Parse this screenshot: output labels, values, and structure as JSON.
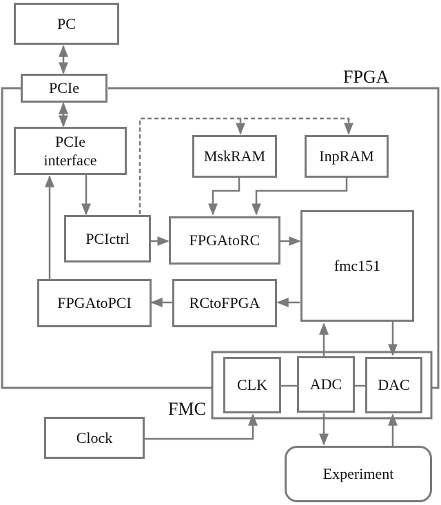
{
  "diagram": {
    "regions": {
      "fpga": "FPGA",
      "fmc": "FMC"
    },
    "blocks": {
      "pc": "PC",
      "pcie": "PCIe",
      "pcie_interface_line1": "PCIe",
      "pcie_interface_line2": "interface",
      "mskram": "MskRAM",
      "inpram": "InpRAM",
      "pcictrl": "PCIctrl",
      "fpgatorc": "FPGAtoRC",
      "fmc151": "fmc151",
      "fpgatopci": "FPGAtoPCI",
      "rctofpga": "RCtoFPGA",
      "clk": "CLK",
      "adc": "ADC",
      "dac": "DAC",
      "clock": "Clock",
      "experiment": "Experiment"
    },
    "connections": [
      {
        "from": "PC",
        "to": "PCIe",
        "type": "bidirectional"
      },
      {
        "from": "PCIe",
        "to": "PCIe interface",
        "type": "bidirectional"
      },
      {
        "from": "PCIe interface",
        "to": "PCIctrl",
        "type": "arrow"
      },
      {
        "from": "PCIctrl",
        "to": "MskRAM",
        "type": "dashed-arrow"
      },
      {
        "from": "PCIctrl",
        "to": "InpRAM",
        "type": "dashed-arrow"
      },
      {
        "from": "MskRAM",
        "to": "FPGAtoRC",
        "type": "arrow"
      },
      {
        "from": "InpRAM",
        "to": "FPGAtoRC",
        "type": "arrow"
      },
      {
        "from": "PCIctrl",
        "to": "FPGAtoRC",
        "type": "arrow"
      },
      {
        "from": "FPGAtoRC",
        "to": "fmc151",
        "type": "arrow"
      },
      {
        "from": "fmc151",
        "to": "RCtoFPGA",
        "type": "arrow"
      },
      {
        "from": "RCtoFPGA",
        "to": "FPGAtoPCI",
        "type": "arrow"
      },
      {
        "from": "FPGAtoPCI",
        "to": "PCIe interface",
        "type": "arrow"
      },
      {
        "from": "ADC",
        "to": "fmc151",
        "type": "arrow"
      },
      {
        "from": "fmc151",
        "to": "DAC",
        "type": "arrow"
      },
      {
        "from": "Clock",
        "to": "CLK",
        "type": "arrow"
      },
      {
        "from": "ADC",
        "to": "Experiment",
        "type": "arrow"
      },
      {
        "from": "Experiment",
        "to": "DAC",
        "type": "arrow"
      }
    ]
  }
}
